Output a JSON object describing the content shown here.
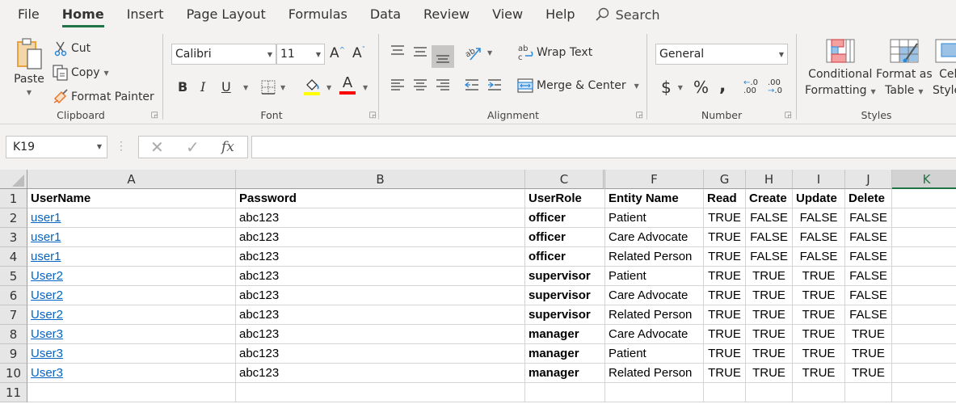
{
  "menu": {
    "tabs": [
      "File",
      "Home",
      "Insert",
      "Page Layout",
      "Formulas",
      "Data",
      "Review",
      "View",
      "Help"
    ],
    "active_tab": "Home",
    "search_label": "Search"
  },
  "ribbon": {
    "clipboard": {
      "label": "Clipboard",
      "paste": "Paste",
      "cut": "Cut",
      "copy": "Copy",
      "format_painter": "Format Painter"
    },
    "font": {
      "label": "Font",
      "font_name": "Calibri",
      "font_size": "11",
      "bold": "B",
      "italic": "I",
      "underline": "U",
      "fill_color": "#ffff00",
      "font_color": "#ff0000"
    },
    "alignment": {
      "label": "Alignment",
      "wrap_text": "Wrap Text",
      "merge_center": "Merge & Center"
    },
    "number": {
      "label": "Number",
      "format": "General",
      "currency": "$",
      "percent": "%",
      "comma": "։"
    },
    "styles": {
      "label": "Styles",
      "conditional_1": "Conditional",
      "conditional_2": "Formatting",
      "format_table_1": "Format as",
      "format_table_2": "Table",
      "cell_styles_1": "Cell",
      "cell_styles_2": "Styles"
    }
  },
  "formula_bar": {
    "name_box": "K19",
    "fx_label": "fx",
    "formula": ""
  },
  "sheet": {
    "columns": [
      "A",
      "B",
      "C",
      "F",
      "G",
      "H",
      "I",
      "J",
      "K"
    ],
    "selected_column": "K",
    "row_numbers": [
      "1",
      "2",
      "3",
      "4",
      "5",
      "6",
      "7",
      "8",
      "9",
      "10",
      "11"
    ],
    "header": [
      "UserName",
      "Password",
      "UserRole",
      "Entity Name",
      "Read",
      "Create",
      "Update",
      "Delete"
    ],
    "rows": [
      [
        "user1",
        "abc123",
        "officer",
        "Patient",
        "TRUE",
        "FALSE",
        "FALSE",
        "FALSE"
      ],
      [
        "user1",
        "abc123",
        "officer",
        "Care Advocate",
        "TRUE",
        "FALSE",
        "FALSE",
        "FALSE"
      ],
      [
        "user1",
        "abc123",
        "officer",
        "Related Person",
        "TRUE",
        "FALSE",
        "FALSE",
        "FALSE"
      ],
      [
        "User2",
        "abc123",
        "supervisor",
        "Patient",
        "TRUE",
        "TRUE",
        "TRUE",
        "FALSE"
      ],
      [
        "User2",
        "abc123",
        "supervisor",
        "Care Advocate",
        "TRUE",
        "TRUE",
        "TRUE",
        "FALSE"
      ],
      [
        "User2",
        "abc123",
        "supervisor",
        "Related Person",
        "TRUE",
        "TRUE",
        "TRUE",
        "FALSE"
      ],
      [
        "User3",
        "abc123",
        "manager",
        "Care Advocate",
        "TRUE",
        "TRUE",
        "TRUE",
        "TRUE"
      ],
      [
        "User3",
        "abc123",
        "manager",
        "Patient",
        "TRUE",
        "TRUE",
        "TRUE",
        "TRUE"
      ],
      [
        "User3",
        "abc123",
        "manager",
        "Related Person",
        "TRUE",
        "TRUE",
        "TRUE",
        "TRUE"
      ]
    ]
  }
}
